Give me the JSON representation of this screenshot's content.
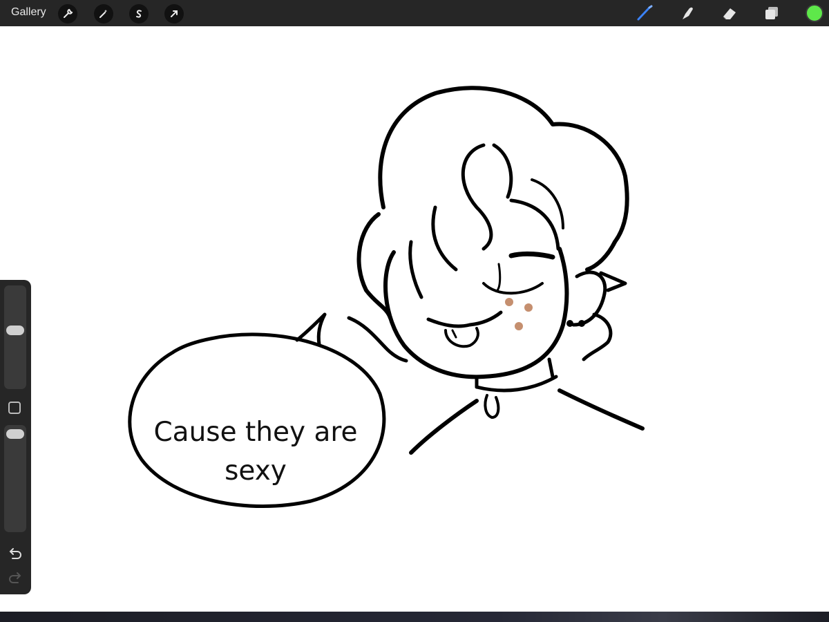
{
  "toolbar": {
    "gallery_label": "Gallery",
    "left_tools": [
      "wrench-icon",
      "magic-wand-icon",
      "selection-icon",
      "transform-arrow-icon"
    ],
    "right_tools": [
      "brush-icon",
      "smudge-icon",
      "eraser-icon",
      "layers-icon"
    ],
    "active_color": "#5ee84a",
    "brush_accent": "#3b82f6"
  },
  "sidebar": {
    "brush_size_level": 0.57,
    "opacity_level": 0.96,
    "buttons": [
      "modify-square-icon",
      "undo-icon",
      "redo-icon"
    ]
  },
  "drawing": {
    "speech_text_line1": "Cause they are",
    "speech_text_line2": "sexy",
    "freckle_color": "#c58f6f"
  }
}
